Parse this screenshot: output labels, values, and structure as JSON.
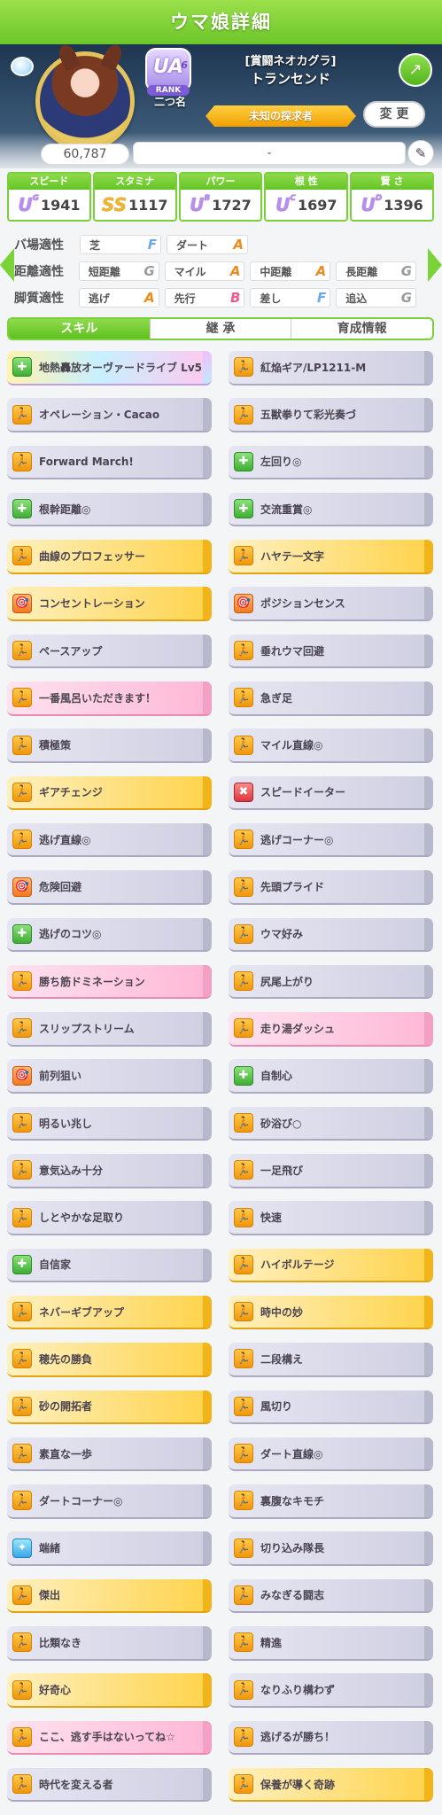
{
  "header": {
    "title": "ウマ娘詳細"
  },
  "profile": {
    "rank_grade": "UA",
    "rank_sub": "6",
    "rank_label": "RANK",
    "nickname": "二つ名",
    "title_line": "[賞闘ネオカグラ]",
    "name": "トランセンド",
    "epithet": "未知の探求者",
    "change_button": "変 更",
    "fans": "60,787",
    "memo": "-"
  },
  "stats": [
    {
      "label": "スピード",
      "icon": "shoe-icon",
      "grade": "U",
      "grade_sub": "G",
      "value": "1941"
    },
    {
      "label": "スタミナ",
      "icon": "heart-icon",
      "grade": "SS",
      "grade_sub": "",
      "value": "1117"
    },
    {
      "label": "パワー",
      "icon": "muscle-icon",
      "grade": "U",
      "grade_sub": "B",
      "value": "1727"
    },
    {
      "label": "根 性",
      "icon": "fire-icon",
      "grade": "U",
      "grade_sub": "C",
      "value": "1697"
    },
    {
      "label": "賢 さ",
      "icon": "cap-icon",
      "grade": "U",
      "grade_sub": "D",
      "value": "1396"
    }
  ],
  "aptitude": [
    {
      "label": "バ場適性",
      "cells": [
        {
          "name": "芝",
          "grade": "F"
        },
        {
          "name": "ダート",
          "grade": "A"
        }
      ]
    },
    {
      "label": "距離適性",
      "cells": [
        {
          "name": "短距離",
          "grade": "G"
        },
        {
          "name": "マイル",
          "grade": "A"
        },
        {
          "name": "中距離",
          "grade": "A"
        },
        {
          "name": "長距離",
          "grade": "G"
        }
      ]
    },
    {
      "label": "脚質適性",
      "cells": [
        {
          "name": "逃げ",
          "grade": "A"
        },
        {
          "name": "先行",
          "grade": "B"
        },
        {
          "name": "差し",
          "grade": "F"
        },
        {
          "name": "追込",
          "grade": "G"
        }
      ]
    }
  ],
  "tabs": [
    "スキル",
    "継 承",
    "育成情報"
  ],
  "skills": [
    {
      "name": "地熱轟放オーヴァードライブ Lv5",
      "style": "rainbow",
      "icon": "green"
    },
    {
      "name": "紅焔ギア/LP1211-M",
      "style": "plain",
      "icon": "orange"
    },
    {
      "name": "オペレーション・Cacao",
      "style": "plain",
      "icon": "orange"
    },
    {
      "name": "五獣拳りて彩光奏づ",
      "style": "plain",
      "icon": "orange"
    },
    {
      "name": "Forward March!",
      "style": "plain",
      "icon": "orange"
    },
    {
      "name": "左回り◎",
      "style": "plain",
      "icon": "green"
    },
    {
      "name": "根幹距離◎",
      "style": "plain",
      "icon": "green"
    },
    {
      "name": "交流重賞◎",
      "style": "plain",
      "icon": "green"
    },
    {
      "name": "曲線のプロフェッサー",
      "style": "gold",
      "icon": "orange"
    },
    {
      "name": "ハヤテ一文字",
      "style": "gold",
      "icon": "orange"
    },
    {
      "name": "コンセントレーション",
      "style": "gold",
      "icon": "orange2"
    },
    {
      "name": "ポジションセンス",
      "style": "plain",
      "icon": "orange2"
    },
    {
      "name": "ペースアップ",
      "style": "plain",
      "icon": "orange"
    },
    {
      "name": "垂れウマ回避",
      "style": "plain",
      "icon": "orange"
    },
    {
      "name": "一番風呂いただきます！",
      "style": "pink",
      "icon": "orange"
    },
    {
      "name": "急ぎ足",
      "style": "plain",
      "icon": "orange"
    },
    {
      "name": "積極策",
      "style": "plain",
      "icon": "orange"
    },
    {
      "name": "マイル直線◎",
      "style": "plain",
      "icon": "orange"
    },
    {
      "name": "ギアチェンジ",
      "style": "gold",
      "icon": "orange"
    },
    {
      "name": "スピードイーター",
      "style": "plain",
      "icon": "red"
    },
    {
      "name": "逃げ直線◎",
      "style": "plain",
      "icon": "orange"
    },
    {
      "name": "逃げコーナー◎",
      "style": "plain",
      "icon": "orange"
    },
    {
      "name": "危険回避",
      "style": "plain",
      "icon": "orange2"
    },
    {
      "name": "先頭プライド",
      "style": "plain",
      "icon": "orange"
    },
    {
      "name": "逃げのコツ◎",
      "style": "plain",
      "icon": "green"
    },
    {
      "name": "ウマ好み",
      "style": "plain",
      "icon": "orange"
    },
    {
      "name": "勝ち筋ドミネーション",
      "style": "pink",
      "icon": "orange"
    },
    {
      "name": "尻尾上がり",
      "style": "plain",
      "icon": "orange"
    },
    {
      "name": "スリップストリーム",
      "style": "plain",
      "icon": "orange"
    },
    {
      "name": "走り湯ダッシュ",
      "style": "pink",
      "icon": "orange"
    },
    {
      "name": "前列狙い",
      "style": "plain",
      "icon": "orange2"
    },
    {
      "name": "自制心",
      "style": "plain",
      "icon": "green"
    },
    {
      "name": "明るい兆し",
      "style": "plain",
      "icon": "orange"
    },
    {
      "name": "砂浴び○",
      "style": "plain",
      "icon": "orange"
    },
    {
      "name": "意気込み十分",
      "style": "plain",
      "icon": "orange"
    },
    {
      "name": "一足飛び",
      "style": "plain",
      "icon": "orange"
    },
    {
      "name": "しとやかな足取り",
      "style": "plain",
      "icon": "orange"
    },
    {
      "name": "快速",
      "style": "plain",
      "icon": "orange"
    },
    {
      "name": "自信家",
      "style": "plain",
      "icon": "green"
    },
    {
      "name": "ハイボルテージ",
      "style": "gold",
      "icon": "orange"
    },
    {
      "name": "ネバーギブアップ",
      "style": "gold",
      "icon": "orange"
    },
    {
      "name": "時中の妙",
      "style": "gold",
      "icon": "orange"
    },
    {
      "name": "穂先の勝負",
      "style": "gold",
      "icon": "orange"
    },
    {
      "name": "二段構え",
      "style": "plain",
      "icon": "orange"
    },
    {
      "name": "砂の開拓者",
      "style": "gold",
      "icon": "orange"
    },
    {
      "name": "風切り",
      "style": "plain",
      "icon": "orange"
    },
    {
      "name": "素直な一歩",
      "style": "plain",
      "icon": "orange"
    },
    {
      "name": "ダート直線◎",
      "style": "plain",
      "icon": "orange"
    },
    {
      "name": "ダートコーナー◎",
      "style": "plain",
      "icon": "orange"
    },
    {
      "name": "裏腹なキモチ",
      "style": "plain",
      "icon": "orange"
    },
    {
      "name": "端緒",
      "style": "plain",
      "icon": "blue"
    },
    {
      "name": "切り込み隊長",
      "style": "plain",
      "icon": "orange"
    },
    {
      "name": "傑出",
      "style": "gold",
      "icon": "orange"
    },
    {
      "name": "みなぎる闘志",
      "style": "plain",
      "icon": "orange"
    },
    {
      "name": "比類なき",
      "style": "plain",
      "icon": "orange"
    },
    {
      "name": "精進",
      "style": "plain",
      "icon": "orange"
    },
    {
      "name": "好奇心",
      "style": "gold",
      "icon": "orange"
    },
    {
      "name": "なりふり構わず",
      "style": "plain",
      "icon": "orange"
    },
    {
      "name": "ここ、逃す手はないってね☆",
      "style": "pink",
      "icon": "orange"
    },
    {
      "name": "逃げるが勝ち！",
      "style": "plain",
      "icon": "orange"
    },
    {
      "name": "時代を変える者",
      "style": "plain",
      "icon": "orange"
    },
    {
      "name": "保養が導く奇跡",
      "style": "gold",
      "icon": "orange"
    }
  ]
}
